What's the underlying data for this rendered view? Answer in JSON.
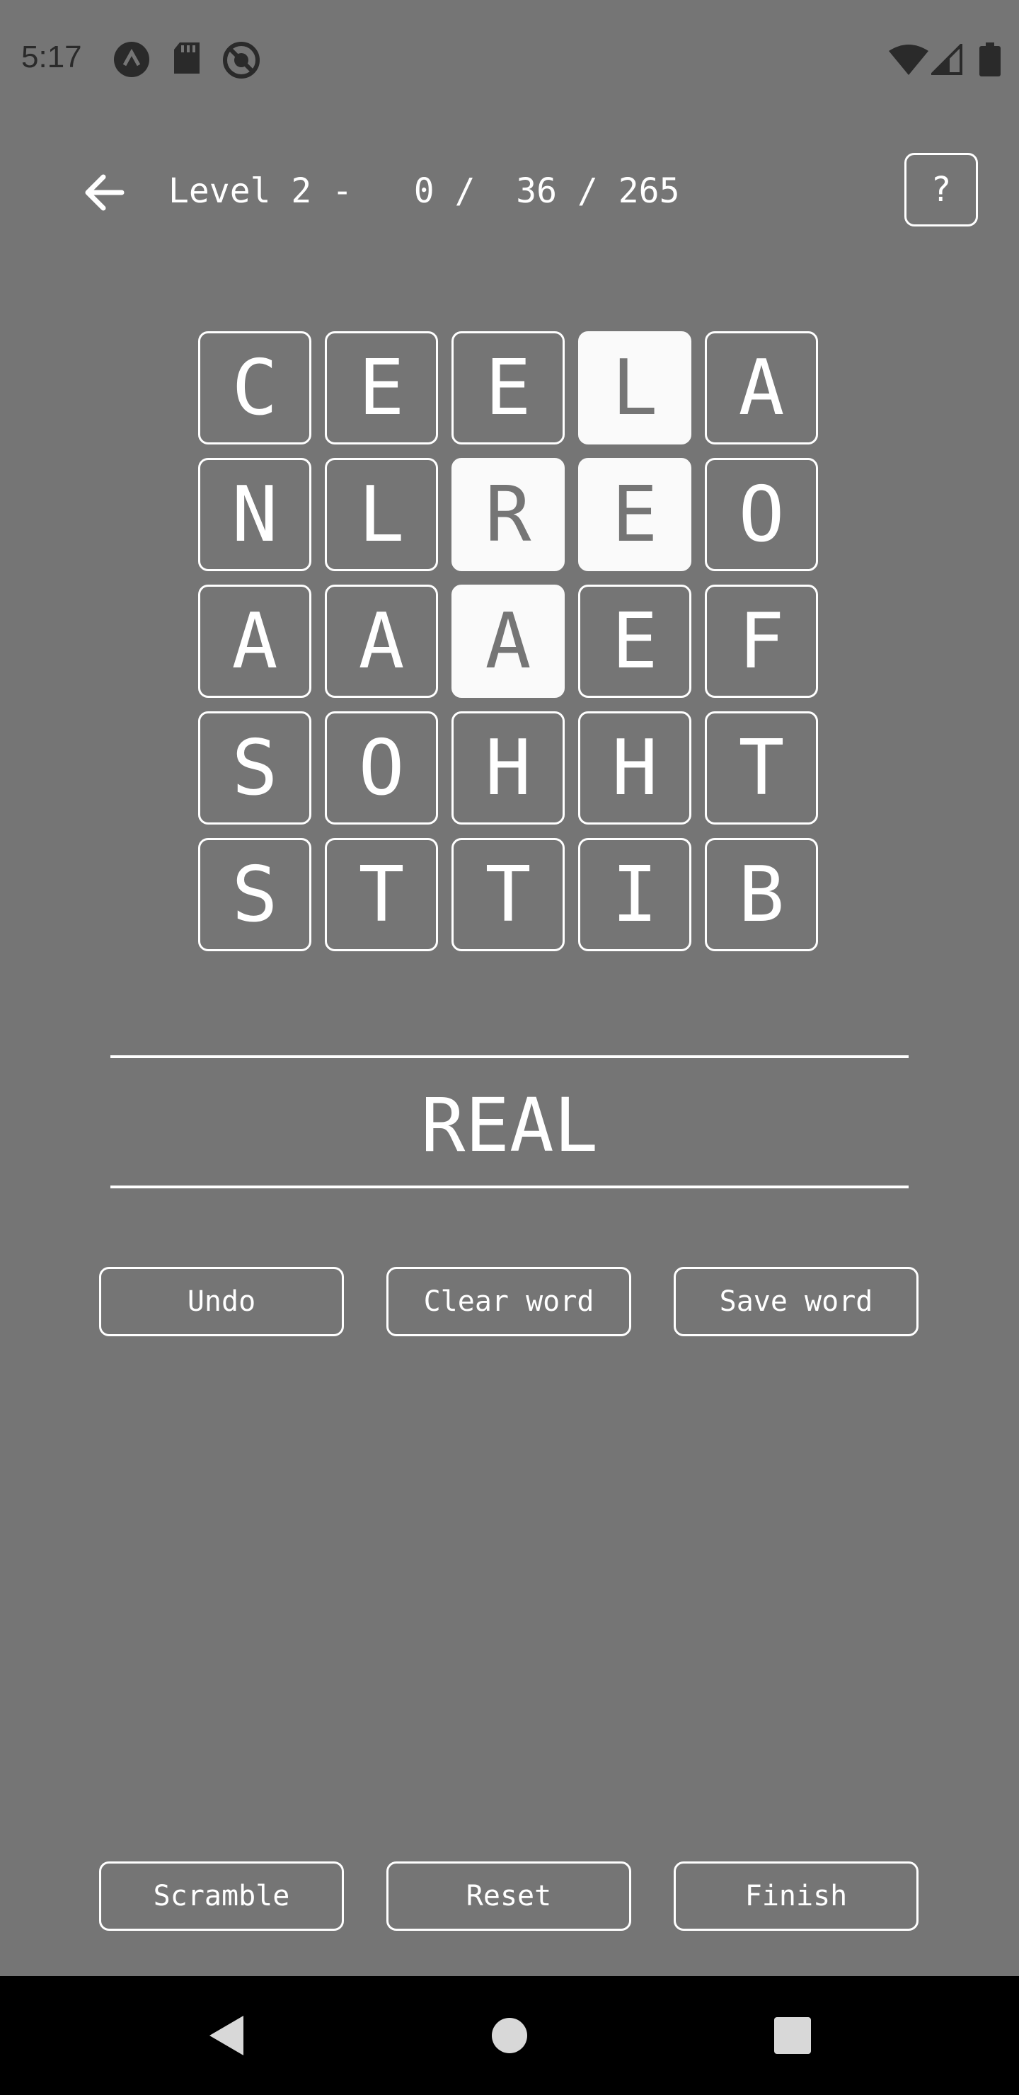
{
  "status_bar": {
    "time": "5:17",
    "left_icons": [
      "a-logo-icon",
      "sd-card-icon",
      "blocked-icon"
    ],
    "right_icons": [
      "wifi-icon",
      "cell-signal-icon",
      "battery-icon"
    ]
  },
  "header": {
    "level_label": "Level 2 -   0 /  36 / 265",
    "help_label": "?"
  },
  "grid": {
    "rows": [
      [
        {
          "letter": "C",
          "selected": false
        },
        {
          "letter": "E",
          "selected": false
        },
        {
          "letter": "E",
          "selected": false
        },
        {
          "letter": "L",
          "selected": true
        },
        {
          "letter": "A",
          "selected": false
        }
      ],
      [
        {
          "letter": "N",
          "selected": false
        },
        {
          "letter": "L",
          "selected": false
        },
        {
          "letter": "R",
          "selected": true
        },
        {
          "letter": "E",
          "selected": true
        },
        {
          "letter": "O",
          "selected": false
        }
      ],
      [
        {
          "letter": "A",
          "selected": false
        },
        {
          "letter": "A",
          "selected": false
        },
        {
          "letter": "A",
          "selected": true
        },
        {
          "letter": "E",
          "selected": false
        },
        {
          "letter": "F",
          "selected": false
        }
      ],
      [
        {
          "letter": "S",
          "selected": false
        },
        {
          "letter": "O",
          "selected": false
        },
        {
          "letter": "H",
          "selected": false
        },
        {
          "letter": "H",
          "selected": false
        },
        {
          "letter": "T",
          "selected": false
        }
      ],
      [
        {
          "letter": "S",
          "selected": false
        },
        {
          "letter": "T",
          "selected": false
        },
        {
          "letter": "T",
          "selected": false
        },
        {
          "letter": "I",
          "selected": false
        },
        {
          "letter": "B",
          "selected": false
        }
      ]
    ]
  },
  "current_word": "REAL",
  "word_actions": {
    "undo": "Undo",
    "clear_word": "Clear word",
    "save_word": "Save word"
  },
  "game_actions": {
    "scramble": "Scramble",
    "reset": "Reset",
    "finish": "Finish"
  },
  "colors": {
    "background": "#757575",
    "selected_tile": "#fafafa",
    "foreground": "#ffffff"
  }
}
